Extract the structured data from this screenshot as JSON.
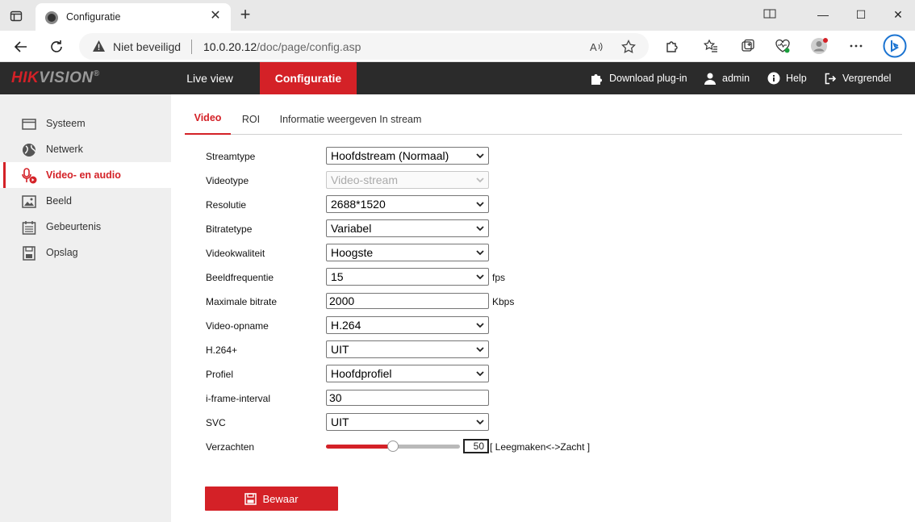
{
  "browser": {
    "tab_title": "Configuratie",
    "security_label": "Niet beveiligd",
    "url_host": "10.0.20.12",
    "url_path": "/doc/page/config.asp"
  },
  "header": {
    "logo_brand": "HIK",
    "logo_rest": "VISION",
    "logo_reg": "®",
    "nav": [
      {
        "label": "Live view"
      },
      {
        "label": "Configuratie"
      }
    ],
    "download_label": "Download plug-in",
    "user_label": "admin",
    "help_label": "Help",
    "lock_label": "Vergrendel"
  },
  "sidebar": {
    "items": [
      {
        "label": "Systeem",
        "icon": "monitor-icon"
      },
      {
        "label": "Netwerk",
        "icon": "globe-icon"
      },
      {
        "label": "Video- en audio",
        "icon": "video-audio-icon"
      },
      {
        "label": "Beeld",
        "icon": "image-icon"
      },
      {
        "label": "Gebeurtenis",
        "icon": "calendar-icon"
      },
      {
        "label": "Opslag",
        "icon": "storage-icon"
      }
    ],
    "active_index": 2
  },
  "subtabs": [
    {
      "label": "Video"
    },
    {
      "label": "ROI"
    },
    {
      "label": "Informatie weergeven In stream"
    }
  ],
  "form": {
    "streamtype": {
      "label": "Streamtype",
      "value": "Hoofdstream (Normaal)"
    },
    "videotype": {
      "label": "Videotype",
      "value": "Video-stream"
    },
    "resolution": {
      "label": "Resolutie",
      "value": "2688*1520"
    },
    "bitratetype": {
      "label": "Bitratetype",
      "value": "Variabel"
    },
    "quality": {
      "label": "Videokwaliteit",
      "value": "Hoogste"
    },
    "framerate": {
      "label": "Beeldfrequentie",
      "value": "15",
      "unit": "fps"
    },
    "maxbitrate": {
      "label": "Maximale bitrate",
      "value": "2000",
      "unit": "Kbps"
    },
    "encoding": {
      "label": "Video-opname",
      "value": "H.264"
    },
    "h264plus": {
      "label": "H.264+",
      "value": "UIT"
    },
    "profile": {
      "label": "Profiel",
      "value": "Hoofdprofiel"
    },
    "iframe": {
      "label": "i-frame-interval",
      "value": "30"
    },
    "svc": {
      "label": "SVC",
      "value": "UIT"
    },
    "smoothing": {
      "label": "Verzachten",
      "value": "50",
      "fraction": 0.5,
      "hint": "[ Leegmaken<->Zacht ]"
    }
  },
  "save_label": "Bewaar",
  "colors": {
    "accent": "#d42127",
    "header_bg": "#2b2b2b",
    "sidebar_bg": "#efefef"
  }
}
